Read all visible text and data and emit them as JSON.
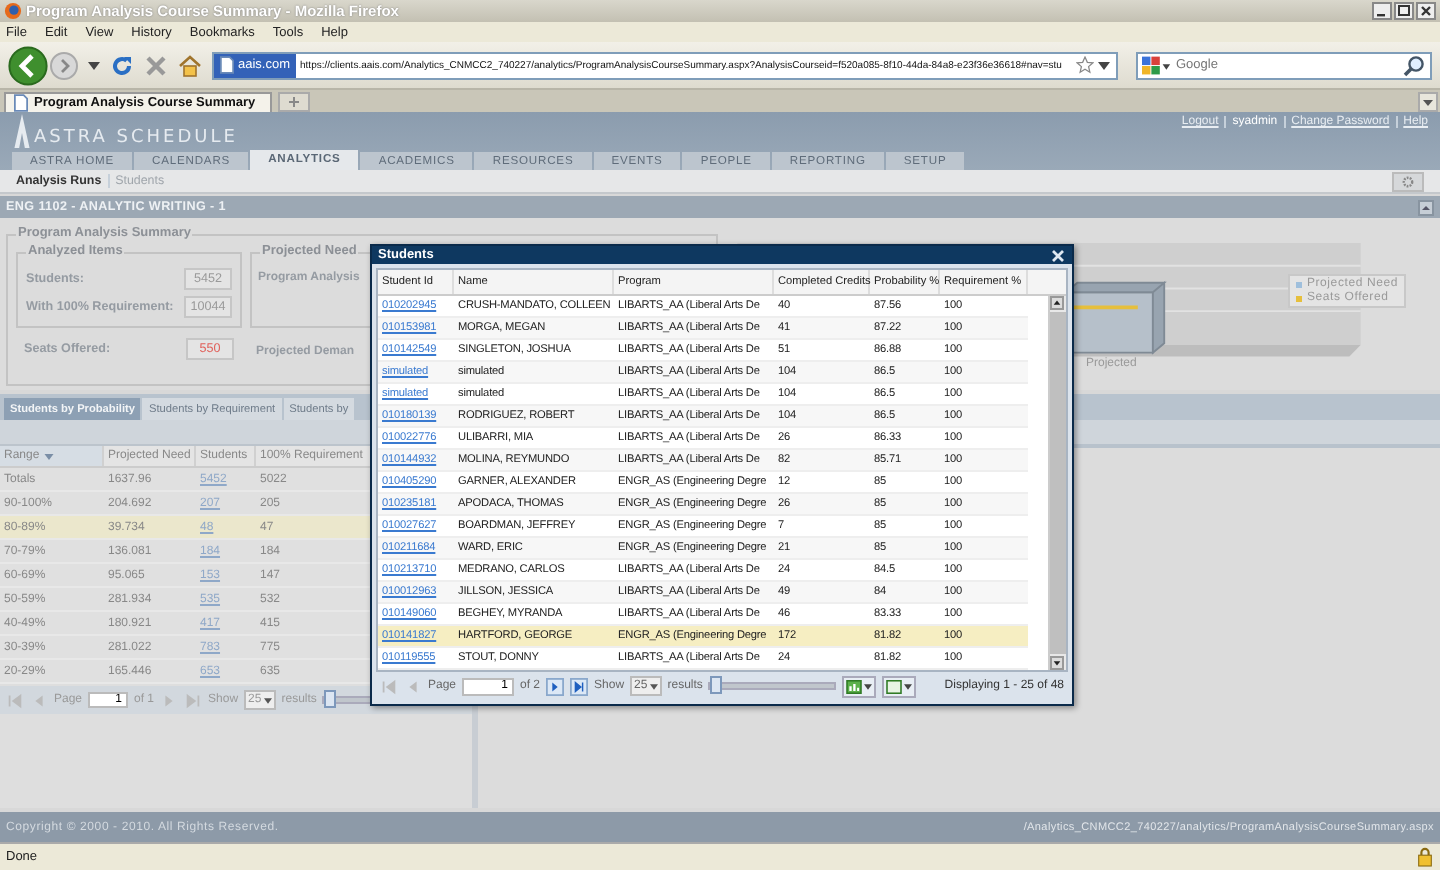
{
  "browser": {
    "title": "Program Analysis Course Summary - Mozilla Firefox",
    "menu": [
      "File",
      "Edit",
      "View",
      "History",
      "Bookmarks",
      "Tools",
      "Help"
    ],
    "url_badge": "aais.com",
    "url": "https://clients.aais.com/Analytics_CNMCC2_740227/analytics/ProgramAnalysisCourseSummary.aspx?AnalysisCourseid=f520a085-8f10-44da-84a8-e23f36e36618#nav=stu",
    "search_placeholder": "Google",
    "tabs": [
      {
        "label": "Program Analysis Course Summary",
        "selected": true
      }
    ]
  },
  "app": {
    "logo": "ASTRA SCHEDULE",
    "user_links": [
      {
        "label": "Logout",
        "kind": "link"
      },
      {
        "label": "syadmin",
        "kind": "text"
      },
      {
        "label": "Change Password",
        "kind": "link"
      },
      {
        "label": "Help",
        "kind": "link"
      }
    ],
    "tabs": [
      {
        "label": "ASTRA HOME",
        "selected": false
      },
      {
        "label": "CALENDARS",
        "selected": false
      },
      {
        "label": "ANALYTICS",
        "selected": true
      },
      {
        "label": "ACADEMICS",
        "selected": false
      },
      {
        "label": "RESOURCES",
        "selected": false
      },
      {
        "label": "EVENTS",
        "selected": false
      },
      {
        "label": "PEOPLE",
        "selected": false
      },
      {
        "label": "REPORTING",
        "selected": false
      },
      {
        "label": "SETUP",
        "selected": false
      }
    ],
    "subnav": [
      {
        "label": "Analysis Runs",
        "selected": true
      },
      {
        "label": "Students",
        "selected": false
      }
    ]
  },
  "course_title": "ENG 1102 - ANALYTIC WRITING - 1",
  "summary": {
    "title": "Program Analysis Summary",
    "analyzed": {
      "title": "Analyzed Items",
      "fields": [
        {
          "label": "Students:",
          "value": "5452",
          "flagged": false
        },
        {
          "label": "With 100% Requirement:",
          "value": "10044",
          "flagged": false
        }
      ]
    },
    "seats": {
      "label": "Seats Offered:",
      "value": "550",
      "flagged": true
    },
    "projected": {
      "title": "Projected Need",
      "label": "Program Analysis"
    },
    "demand_label": "Projected Deman"
  },
  "chart": {
    "category": "Projected",
    "legend": [
      {
        "label": "Projected Need",
        "color": "#9fbfdc"
      },
      {
        "label": "Seats Offered",
        "color": "#e6bf3c"
      }
    ]
  },
  "lower_tabs": [
    {
      "label": "Students by Probability",
      "selected": true
    },
    {
      "label": "Students by Requirement",
      "selected": false
    },
    {
      "label": "Students by",
      "selected": false
    }
  ],
  "grid": {
    "columns": [
      {
        "label": "Range",
        "sorted": true
      },
      {
        "label": "Projected Need",
        "sorted": false
      },
      {
        "label": "Students",
        "sorted": false
      },
      {
        "label": "100% Requirement",
        "sorted": false
      }
    ],
    "rows": [
      {
        "range": "Totals",
        "need": "1637.96",
        "students": "5452",
        "requirement": "5022",
        "selected": false
      },
      {
        "range": "90-100%",
        "need": "204.692",
        "students": "207",
        "requirement": "205",
        "selected": false
      },
      {
        "range": "80-89%",
        "need": "39.734",
        "students": "48",
        "requirement": "47",
        "selected": true
      },
      {
        "range": "70-79%",
        "need": "136.081",
        "students": "184",
        "requirement": "184",
        "selected": false
      },
      {
        "range": "60-69%",
        "need": "95.065",
        "students": "153",
        "requirement": "147",
        "selected": false
      },
      {
        "range": "50-59%",
        "need": "281.934",
        "students": "535",
        "requirement": "532",
        "selected": false
      },
      {
        "range": "40-49%",
        "need": "180.921",
        "students": "417",
        "requirement": "415",
        "selected": false
      },
      {
        "range": "30-39%",
        "need": "281.022",
        "students": "783",
        "requirement": "775",
        "selected": false
      },
      {
        "range": "20-29%",
        "need": "165.446",
        "students": "653",
        "requirement": "635",
        "selected": false
      }
    ],
    "pager": {
      "page_label": "Page",
      "page": "1",
      "of": "of 1",
      "show": "Show",
      "size": "25",
      "results": "results"
    },
    "slider": {
      "level": 0
    }
  },
  "modal": {
    "title": "Students",
    "columns": [
      "Student Id",
      "Name",
      "Program",
      "Completed Credits",
      "Probability %",
      "Requirement %"
    ],
    "rows": [
      {
        "id": "010202945",
        "name": "CRUSH-MANDATO, COLLEEN",
        "program": "LIBARTS_AA (Liberal Arts De",
        "credits": "40",
        "probability": "87.56",
        "requirement": "100",
        "selected": false
      },
      {
        "id": "010153981",
        "name": "MORGA, MEGAN",
        "program": "LIBARTS_AA (Liberal Arts De",
        "credits": "41",
        "probability": "87.22",
        "requirement": "100",
        "selected": false
      },
      {
        "id": "010142549",
        "name": "SINGLETON, JOSHUA",
        "program": "LIBARTS_AA (Liberal Arts De",
        "credits": "51",
        "probability": "86.88",
        "requirement": "100",
        "selected": false
      },
      {
        "id": "simulated",
        "name": "simulated",
        "program": "LIBARTS_AA (Liberal Arts De",
        "credits": "104",
        "probability": "86.5",
        "requirement": "100",
        "selected": false
      },
      {
        "id": "simulated",
        "name": "simulated",
        "program": "LIBARTS_AA (Liberal Arts De",
        "credits": "104",
        "probability": "86.5",
        "requirement": "100",
        "selected": false
      },
      {
        "id": "010180139",
        "name": "RODRIGUEZ, ROBERT",
        "program": "LIBARTS_AA (Liberal Arts De",
        "credits": "104",
        "probability": "86.5",
        "requirement": "100",
        "selected": false
      },
      {
        "id": "010022776",
        "name": "ULIBARRI, MIA",
        "program": "LIBARTS_AA (Liberal Arts De",
        "credits": "26",
        "probability": "86.33",
        "requirement": "100",
        "selected": false
      },
      {
        "id": "010144932",
        "name": "MOLINA, REYMUNDO",
        "program": "LIBARTS_AA (Liberal Arts De",
        "credits": "82",
        "probability": "85.71",
        "requirement": "100",
        "selected": false
      },
      {
        "id": "010405290",
        "name": "GARNER, ALEXANDER",
        "program": "ENGR_AS (Engineering Degre",
        "credits": "12",
        "probability": "85",
        "requirement": "100",
        "selected": false
      },
      {
        "id": "010235181",
        "name": "APODACA, THOMAS",
        "program": "ENGR_AS (Engineering Degre",
        "credits": "26",
        "probability": "85",
        "requirement": "100",
        "selected": false
      },
      {
        "id": "010027627",
        "name": "BOARDMAN, JEFFREY",
        "program": "ENGR_AS (Engineering Degre",
        "credits": "7",
        "probability": "85",
        "requirement": "100",
        "selected": false
      },
      {
        "id": "010211684",
        "name": "WARD, ERIC",
        "program": "ENGR_AS (Engineering Degre",
        "credits": "21",
        "probability": "85",
        "requirement": "100",
        "selected": false
      },
      {
        "id": "010213710",
        "name": "MEDRANO, CARLOS",
        "program": "LIBARTS_AA (Liberal Arts De",
        "credits": "24",
        "probability": "84.5",
        "requirement": "100",
        "selected": false
      },
      {
        "id": "010012963",
        "name": "JILLSON, JESSICA",
        "program": "LIBARTS_AA (Liberal Arts De",
        "credits": "49",
        "probability": "84",
        "requirement": "100",
        "selected": false
      },
      {
        "id": "010149060",
        "name": "BEGHEY, MYRANDA",
        "program": "LIBARTS_AA (Liberal Arts De",
        "credits": "46",
        "probability": "83.33",
        "requirement": "100",
        "selected": false
      },
      {
        "id": "010141827",
        "name": "HARTFORD, GEORGE",
        "program": "ENGR_AS (Engineering Degre",
        "credits": "172",
        "probability": "81.82",
        "requirement": "100",
        "selected": true
      },
      {
        "id": "010119555",
        "name": "STOUT, DONNY",
        "program": "LIBARTS_AA (Liberal Arts De",
        "credits": "24",
        "probability": "81.82",
        "requirement": "100",
        "selected": false
      }
    ],
    "pager": {
      "page_label": "Page",
      "page": "1",
      "of": "of 2",
      "show": "Show",
      "size": "25",
      "results": "results",
      "displaying": "Displaying 1 - 25 of 48"
    },
    "slider": {
      "level": 0
    }
  },
  "footer": {
    "copyright": "Copyright © 2000 - 2010.  All Rights Reserved.",
    "path": "/Analytics_CNMCC2_740227/analytics/ProgramAnalysisCourseSummary.aspx"
  },
  "status": "Done"
}
